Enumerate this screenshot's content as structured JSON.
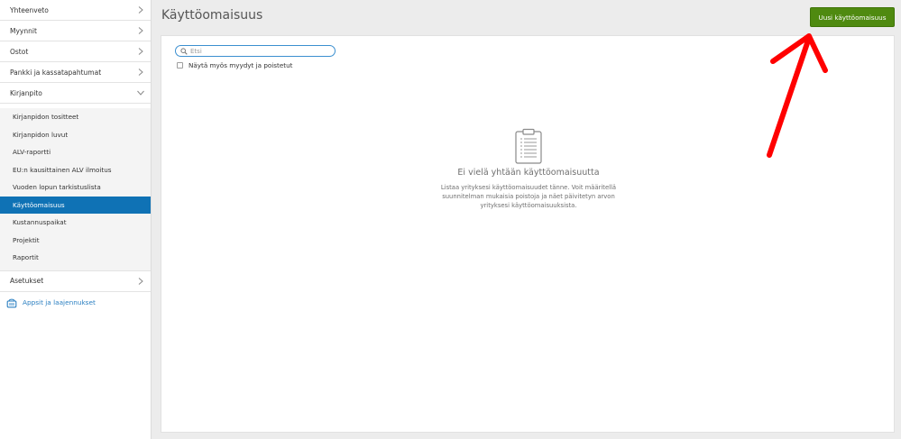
{
  "sidebar": {
    "items": [
      {
        "label": "Yhteenveto"
      },
      {
        "label": "Myynnit"
      },
      {
        "label": "Ostot"
      },
      {
        "label": "Pankki ja kassatapahtumat"
      },
      {
        "label": "Kirjanpito"
      }
    ],
    "kirjanpito_sub": [
      {
        "label": "Kirjanpidon tositteet"
      },
      {
        "label": "Kirjanpidon luvut"
      },
      {
        "label": "ALV-raportti"
      },
      {
        "label": "EU:n kausittainen ALV ilmoitus"
      },
      {
        "label": "Vuoden lopun tarkistuslista"
      },
      {
        "label": "Käyttöomaisuus"
      },
      {
        "label": "Kustannuspaikat"
      },
      {
        "label": "Projektit"
      },
      {
        "label": "Raportit"
      }
    ],
    "settings_label": "Asetukset",
    "apps_label": "Appsit ja laajennukset"
  },
  "header": {
    "title": "Käyttöomaisuus",
    "new_button_label": "Uusi käyttöomaisuus"
  },
  "filters": {
    "search_placeholder": "Etsi",
    "show_sold_label": "Näytä myös myydyt ja poistetut"
  },
  "empty_state": {
    "title": "Ei vielä yhtään käyttöomaisuutta",
    "description": "Listaa yrityksesi käyttöomaisuudet tänne. Voit määritellä suunnitelman mukaisia poistoja ja näet päivitetyn arvon yrityksesi käyttöomaisuuksista."
  },
  "colors": {
    "accent_blue": "#0f72b5",
    "button_green": "#4f8a10",
    "annotation_red": "#ff0000"
  }
}
